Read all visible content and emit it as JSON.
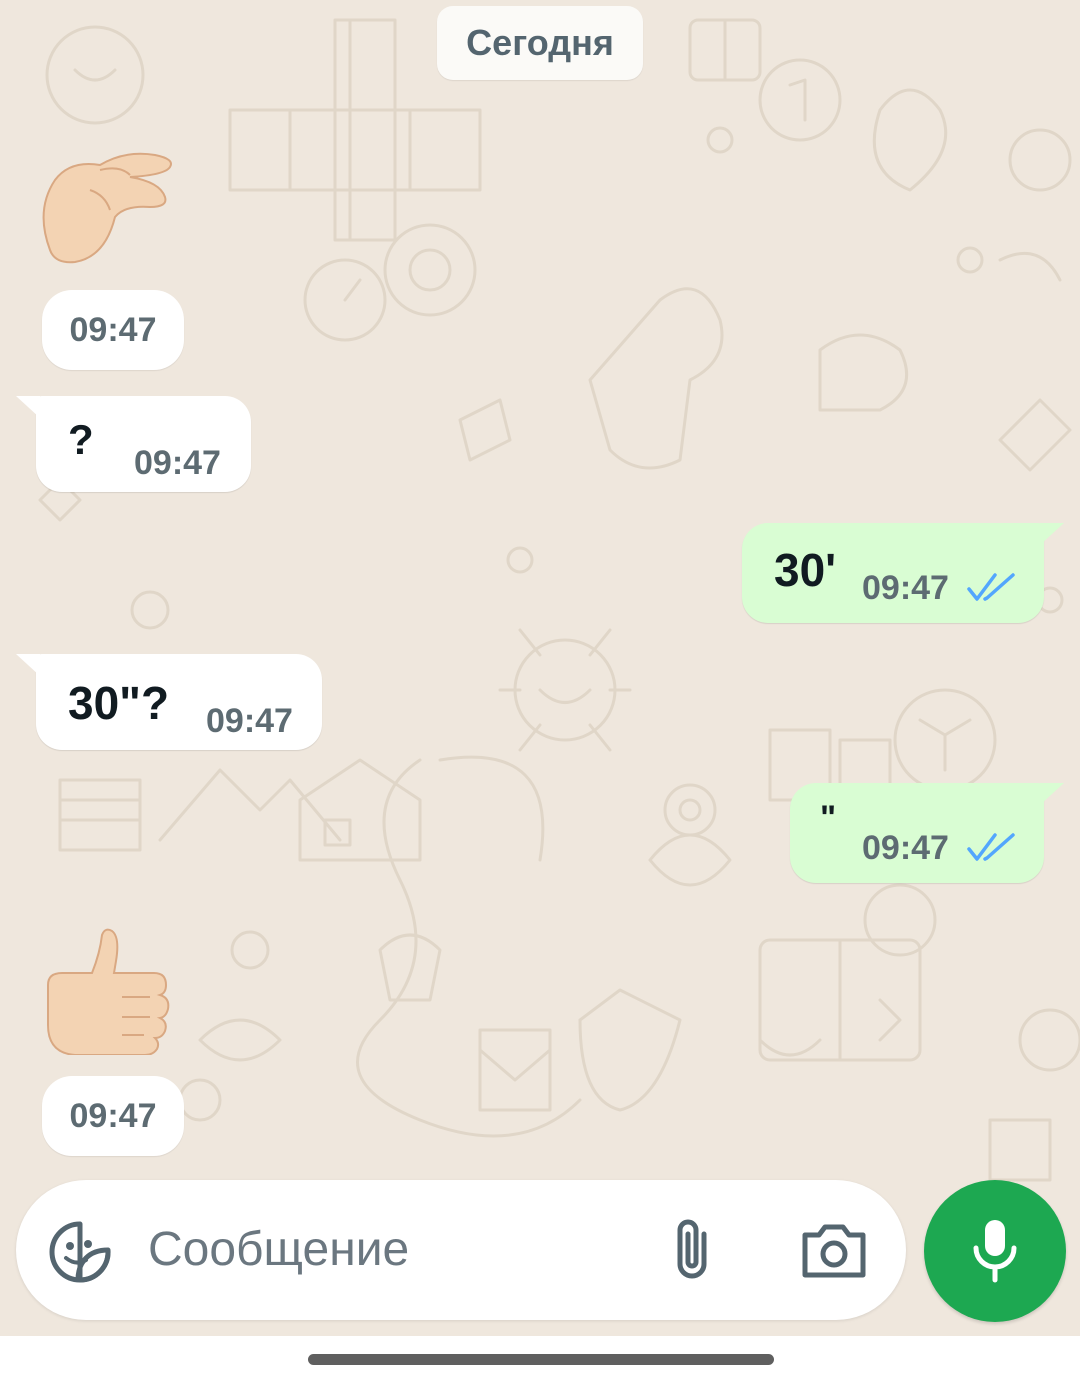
{
  "date_chip": "Сегодня",
  "messages": [
    {
      "direction": "in",
      "kind": "emoji",
      "emoji_name": "pinching-hand",
      "time": "09:47"
    },
    {
      "direction": "in",
      "kind": "text",
      "text": "?",
      "time": "09:47"
    },
    {
      "direction": "out",
      "kind": "text",
      "text": "30'",
      "time": "09:47",
      "status": "read"
    },
    {
      "direction": "in",
      "kind": "text",
      "text": "30\"?",
      "time": "09:47"
    },
    {
      "direction": "out",
      "kind": "text",
      "text": "\"",
      "time": "09:47",
      "status": "read"
    },
    {
      "direction": "in",
      "kind": "emoji",
      "emoji_name": "thumbs-up",
      "time": "09:47"
    }
  ],
  "composer": {
    "placeholder": "Сообщение",
    "icons": [
      "sticker-icon",
      "paperclip-icon",
      "camera-icon",
      "microphone-icon"
    ]
  },
  "colors": {
    "background": "#efe7dd",
    "incoming_bubble": "#ffffff",
    "outgoing_bubble": "#d9fdd3",
    "read_ticks": "#53a6fd",
    "mic_button": "#1da851"
  }
}
